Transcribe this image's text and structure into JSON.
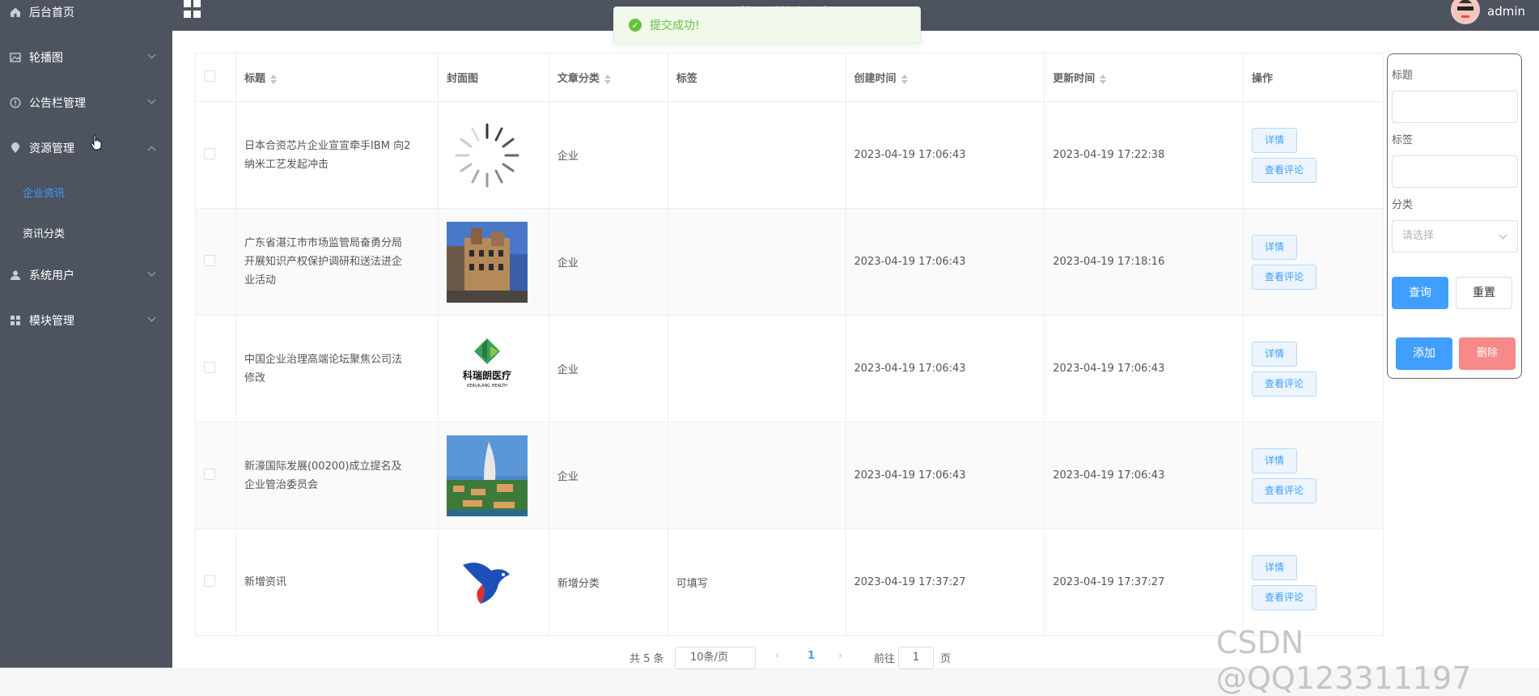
{
  "sidebar": {
    "items": [
      {
        "label": "后台首页",
        "icon": "home-icon"
      },
      {
        "label": "轮播图",
        "icon": "image-icon"
      },
      {
        "label": "公告栏管理",
        "icon": "info-circle-icon"
      },
      {
        "label": "资源管理",
        "icon": "location-pin-icon"
      },
      {
        "label": "系统用户",
        "icon": "user-icon"
      },
      {
        "label": "模块管理",
        "icon": "grid-icon"
      }
    ],
    "sub_items": [
      {
        "label": "企业资讯",
        "active": true
      },
      {
        "label": "资讯分类",
        "active": false
      }
    ]
  },
  "header": {
    "title": "...管理系统小程序",
    "user": "admin"
  },
  "toast": {
    "message": "提交成功!",
    "color": "#67c23a"
  },
  "table": {
    "columns": [
      "标题",
      "封面图",
      "文章分类",
      "标签",
      "创建时间",
      "更新时间",
      "操作"
    ],
    "rows": [
      {
        "title": "日本合资芯片企业宣宣牵手IBM 向2纳米工艺发起冲击",
        "category": "企业",
        "tag": "",
        "created": "2023-04-19 17:06:43",
        "updated": "2023-04-19 17:22:38",
        "cover": "loading"
      },
      {
        "title": "广东省湛江市市场监管局奋勇分局开展知识产权保护调研和送法进企业活动",
        "category": "企业",
        "tag": "",
        "created": "2023-04-19 17:06:43",
        "updated": "2023-04-19 17:18:16",
        "cover": "building"
      },
      {
        "title": "中国企业治理高端论坛聚焦公司法修改",
        "category": "企业",
        "tag": "",
        "created": "2023-04-19 17:06:43",
        "updated": "2023-04-19 17:06:43",
        "cover": "logo",
        "logo_text": "科瑞朗医疗",
        "logo_sub": "KERUILANG HEALTH"
      },
      {
        "title": "新濠国际发展(00200)成立提名及企业管治委员会",
        "category": "企业",
        "tag": "",
        "created": "2023-04-19 17:06:43",
        "updated": "2023-04-19 17:06:43",
        "cover": "resort"
      },
      {
        "title": "新增资讯",
        "category": "新增分类",
        "tag": "可填写",
        "created": "2023-04-19 17:37:27",
        "updated": "2023-04-19 17:37:27",
        "cover": "bird"
      }
    ],
    "detail_label": "详情",
    "comment_label": "查看评论"
  },
  "search": {
    "title_label": "标题",
    "tag_label": "标签",
    "category_label": "分类",
    "category_placeholder": "请选择",
    "query_label": "查询",
    "reset_label": "重置",
    "add_label": "添加",
    "delete_label": "删除"
  },
  "pager": {
    "total": "共 5 条",
    "size": "10条/页",
    "current": "1",
    "goto": "前往",
    "goto_value": "1",
    "page_unit": "页"
  },
  "watermark": "CSDN @QQ123311197"
}
